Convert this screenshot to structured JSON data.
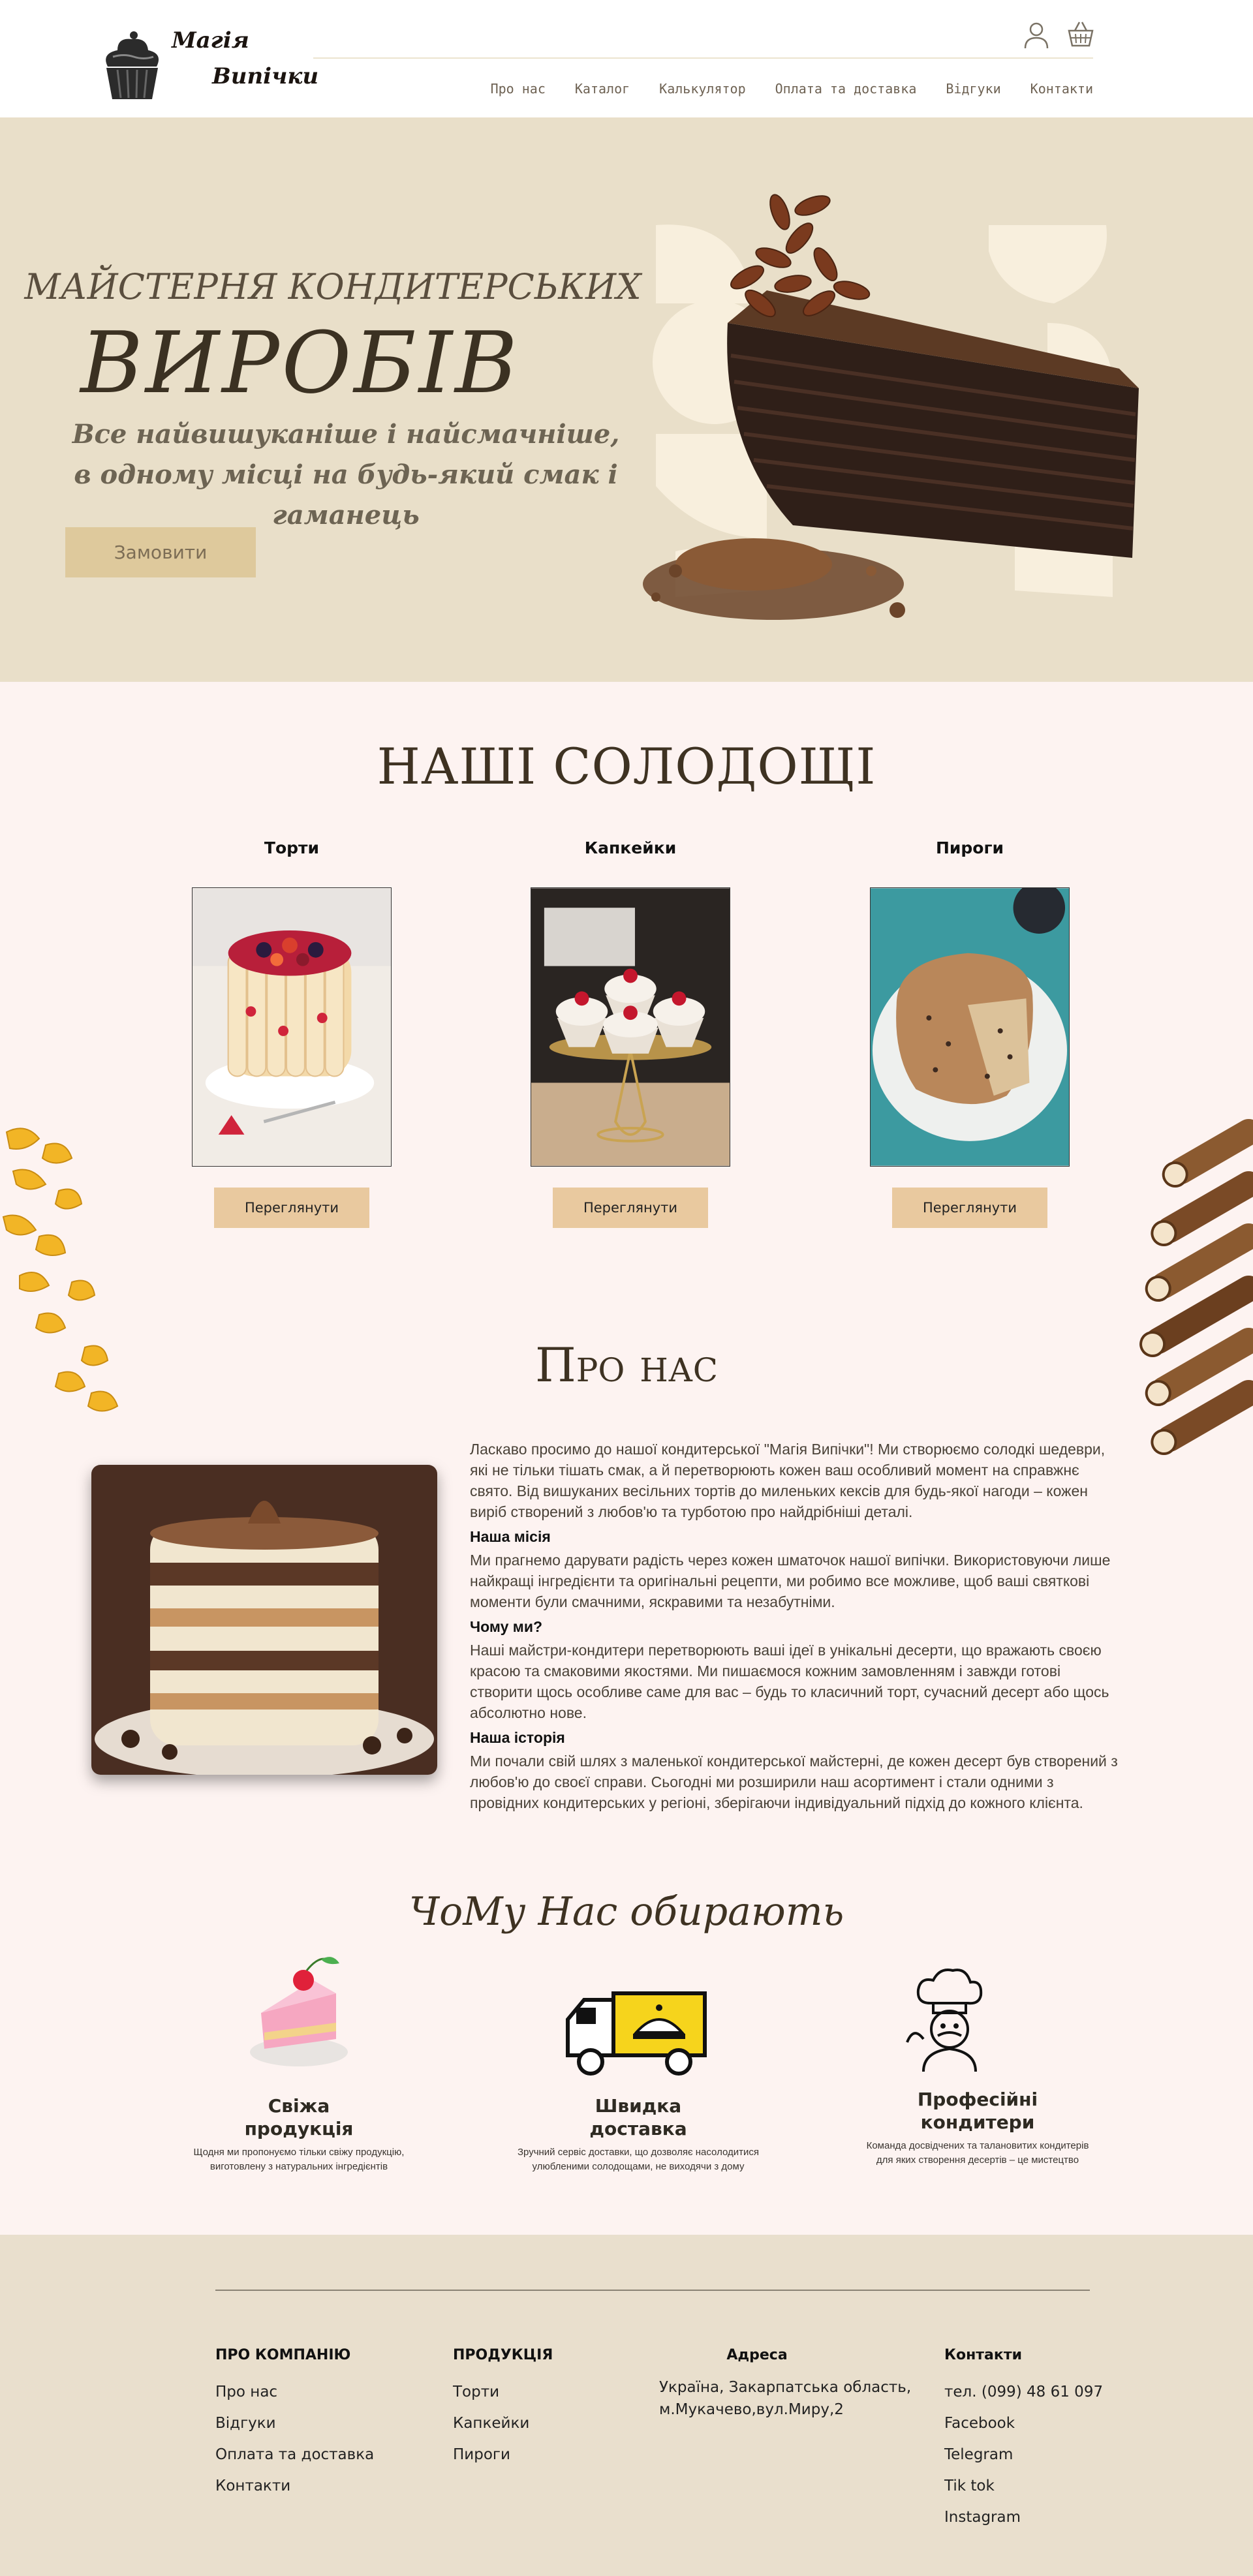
{
  "header": {
    "logo_line1": "Магія",
    "logo_line2": "Випічки",
    "nav": [
      "Про нас",
      "Каталог",
      "Калькулятор",
      "Оплата та доставка",
      "Відгуки",
      "Контакти"
    ]
  },
  "hero": {
    "kicker": "МАЙСТЕРНЯ КОНДИТЕРСЬКИХ",
    "title": "ВИРОБІВ",
    "subtitle_line1": "Все найвишуканіше і найсмачніше,",
    "subtitle_line2": "в одному місці на будь-який смак і гаманець",
    "order_button": "Замовити"
  },
  "sweets": {
    "title": "НАШІ СОЛОДОЩІ",
    "cards": [
      {
        "label": "Торти",
        "button": "Переглянути"
      },
      {
        "label": "Капкейки",
        "button": "Переглянути"
      },
      {
        "label": "Пироги",
        "button": "Переглянути"
      }
    ]
  },
  "about": {
    "title": "Про нас",
    "intro": "Ласкаво просимо до нашої кондитерської \"Магія Випічки\"! Ми створюємо солодкі шедеври, які не тільки тішать смак, а й перетворюють кожен ваш особливий момент на справжнє свято. Від вишуканих весільних тортів до миленьких кексів для будь-якої нагоди – кожен виріб створений з любов'ю та турботою про найдрібніші деталі.",
    "mission_heading": "Наша місія",
    "mission_text": "Ми прагнемо дарувати радість через кожен шматочок нашої випічки. Використовуючи лише найкращі інгредієнти та оригінальні рецепти, ми робимо все можливе, щоб ваші святкові моменти були смачними, яскравими та незабутніми.",
    "why_heading": "Чому ми?",
    "why_text": "Наші майстри-кондитери перетворюють ваші ідеї в унікальні десерти, що вражають своєю красою та смаковими якостями. Ми пишаємося кожним замовленням і завжди готові створити щось особливе саме для вас – будь то класичний торт, сучасний десерт або щось абсолютно нове.",
    "history_heading": "Наша історія",
    "history_text": "Ми почали свій шлях з маленької кондитерської майстерні, де кожен десерт був створений з любов'ю до своєї справи. Сьогодні ми розширили наш асортимент і стали одними з провідних кондитерських у регіоні, зберігаючи індивідуальний підхід до кожного клієнта."
  },
  "why": {
    "title": "ЧоМу Нас обирають",
    "features": [
      {
        "title_line1": "Свіжа",
        "title_line2": "продукція",
        "text_line1": "Щодня ми пропонуємо тільки свіжу продукцію,",
        "text_line2": "виготовлену з натуральних інгредієнтів"
      },
      {
        "title_line1": "Швидка",
        "title_line2": "доставка",
        "text_line1": "Зручний сервіс доставки, що дозволяє насолодитися",
        "text_line2": "улюбленими солодощами, не виходячи з дому"
      },
      {
        "title_line1": "Професійні",
        "title_line2": "кондитери",
        "text_line1": "Команда досвідчених та талановитих кондитерів",
        "text_line2": "для яких створення десертів – це мистецтво"
      }
    ]
  },
  "footer": {
    "company_heading": "ПРО КОМПАНІЮ",
    "company_links": [
      "Про нас",
      "Відгуки",
      "Оплата та доставка",
      "Контакти"
    ],
    "products_heading": "ПРОДУКЦІЯ",
    "products_links": [
      "Торти",
      "Капкейки",
      "Пироги"
    ],
    "address_heading": "Адреса",
    "address_line1": "Україна, Закарпатська область,",
    "address_line2": "м.Мукачево,вул.Миру,2",
    "contacts_heading": "Контакти",
    "contacts": [
      "тел. (099) 48 61 097",
      "Facebook",
      "Telegram",
      "Tik tok",
      "Instagram"
    ]
  },
  "colors": {
    "hero_bg": "#e9dfc9",
    "page_bg": "#fdf3f1",
    "footer_bg": "#e9dfcd",
    "button_gold": "#dec99c",
    "button_peach": "#e9c99f"
  }
}
